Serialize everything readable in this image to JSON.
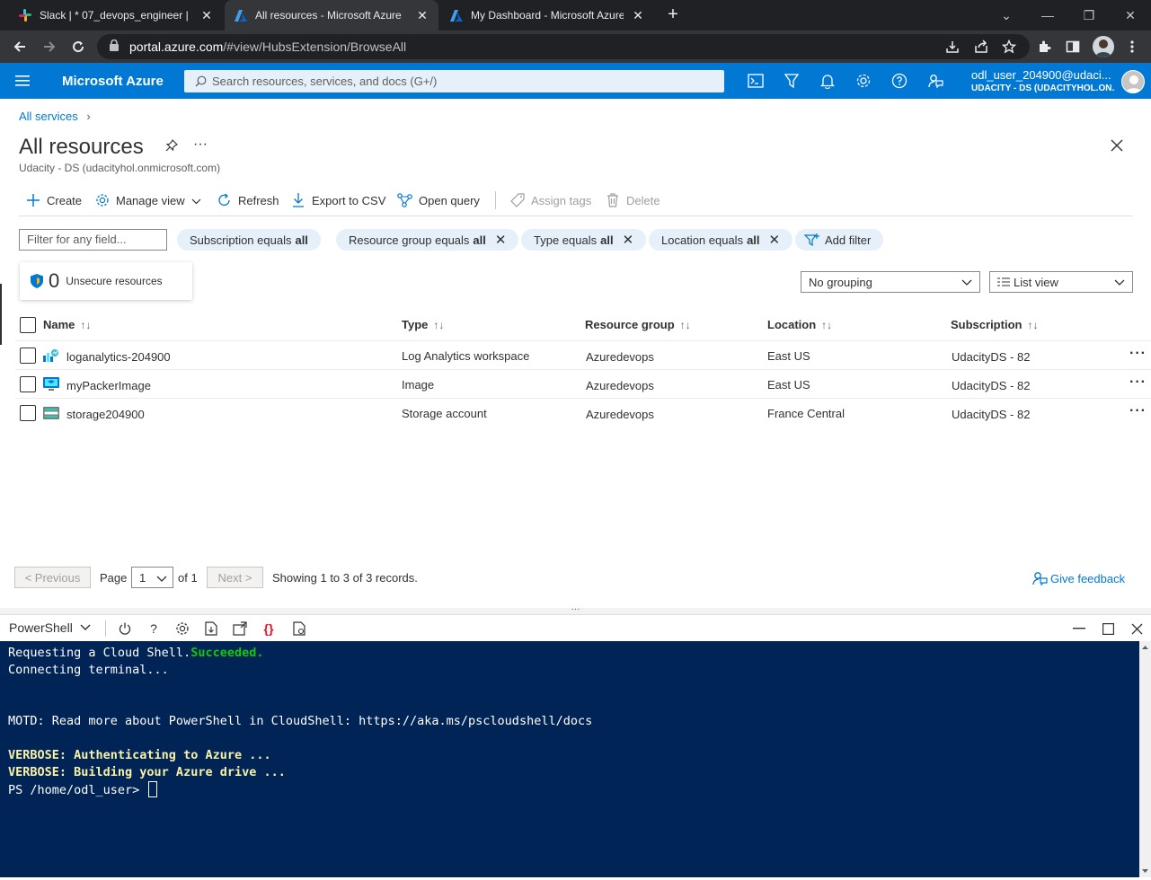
{
  "browser": {
    "tabs": [
      {
        "label": "Slack | * 07_devops_engineer | Bo",
        "icon": "slack-icon",
        "active": false
      },
      {
        "label": "All resources - Microsoft Azure",
        "icon": "azure-icon",
        "active": true
      },
      {
        "label": "My Dashboard - Microsoft Azure",
        "icon": "azure-icon",
        "active": false
      }
    ],
    "new_tab": "+",
    "url_host": "portal.azure.com",
    "url_path": "/#view/HubsExtension/BrowseAll"
  },
  "azure": {
    "brand": "Microsoft Azure",
    "search_placeholder": "Search resources, services, and docs (G+/)",
    "user_name": "odl_user_204900@udaci...",
    "user_tenant": "UDACITY - DS (UDACITYHOL.ON..."
  },
  "page": {
    "breadcrumb": "All services",
    "title": "All resources",
    "subtitle": "Udacity - DS (udacityhol.onmicrosoft.com)",
    "commands": {
      "create": "Create",
      "manage_view": "Manage view",
      "refresh": "Refresh",
      "export_csv": "Export to CSV",
      "open_query": "Open query",
      "assign_tags": "Assign tags",
      "delete": "Delete"
    },
    "filter_placeholder": "Filter for any field...",
    "filters": [
      {
        "label": "Subscription equals",
        "value": "all"
      },
      {
        "label": "Resource group equals",
        "value": "all"
      },
      {
        "label": "Type equals",
        "value": "all"
      },
      {
        "label": "Location equals",
        "value": "all"
      }
    ],
    "add_filter": "Add filter",
    "unsecure_count": "0",
    "unsecure_label": "Unsecure resources",
    "grouping": "No grouping",
    "view": "List view",
    "columns": [
      "Name",
      "Type",
      "Resource group",
      "Location",
      "Subscription"
    ],
    "rows": [
      {
        "name": "loganalytics-204900",
        "icon": "log-analytics-icon",
        "type": "Log Analytics workspace",
        "resource_group": "Azuredevops",
        "location": "East US",
        "subscription": "UdacityDS - 82"
      },
      {
        "name": "myPackerImage",
        "icon": "vm-image-icon",
        "type": "Image",
        "resource_group": "Azuredevops",
        "location": "East US",
        "subscription": "UdacityDS - 82"
      },
      {
        "name": "storage204900",
        "icon": "storage-account-icon",
        "type": "Storage account",
        "resource_group": "Azuredevops",
        "location": "France Central",
        "subscription": "UdacityDS - 82"
      }
    ],
    "pagination": {
      "previous": "< Previous",
      "page_label": "Page",
      "page_value": "1",
      "of_label": "of 1",
      "next": "Next >",
      "showing": "Showing 1 to 3 of 3 records."
    },
    "give_feedback": "Give feedback"
  },
  "shell": {
    "type": "PowerShell",
    "lines": {
      "l1_a": "Requesting a Cloud Shell.",
      "l1_b": "Succeeded.",
      "l2": "Connecting terminal...",
      "l3": "MOTD: Read more about PowerShell in CloudShell: https://aka.ms/pscloudshell/docs",
      "l4": "VERBOSE: Authenticating to Azure ...",
      "l5": "VERBOSE: Building your Azure drive ...",
      "prompt": "PS /home/odl_user> "
    }
  },
  "colors": {
    "azure_blue": "#0078d4",
    "shell_bg": "#012456",
    "success": "#16c60c",
    "verbose": "#f9f1a5"
  }
}
